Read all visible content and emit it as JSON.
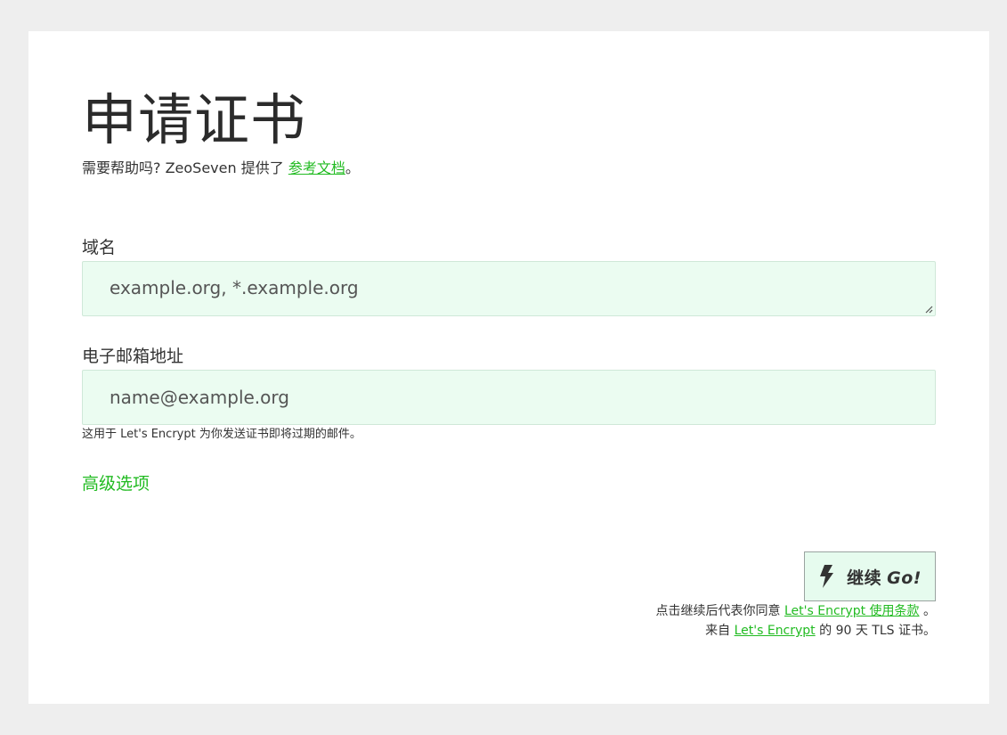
{
  "header": {
    "title": "申请证书",
    "help_prefix": "需要帮助吗?   ZeoSeven 提供了 ",
    "help_link": "参考文档",
    "help_suffix": "。"
  },
  "form": {
    "domains": {
      "label": "域名",
      "placeholder": "example.org, *.example.org"
    },
    "email": {
      "label": "电子邮箱地址",
      "placeholder": "name@example.org",
      "hint": "这用于 Let's Encrypt 为你发送证书即将过期的邮件。"
    },
    "advanced_link": "高级选项"
  },
  "submit": {
    "icon": "lightning-bolt-icon",
    "label": "继续",
    "label_em": "Go!"
  },
  "footer": {
    "terms_prefix": "点击继续后代表你同意 ",
    "terms_link": "Let's Encrypt 使用条款",
    "terms_suffix": " 。",
    "source_prefix": "来自 ",
    "source_link": "Let's Encrypt",
    "source_suffix": " 的 90 天 TLS 证书。"
  },
  "colors": {
    "accent": "#22bb22",
    "input_bg": "#ebfcf1",
    "page_bg": "#eeeeee"
  }
}
